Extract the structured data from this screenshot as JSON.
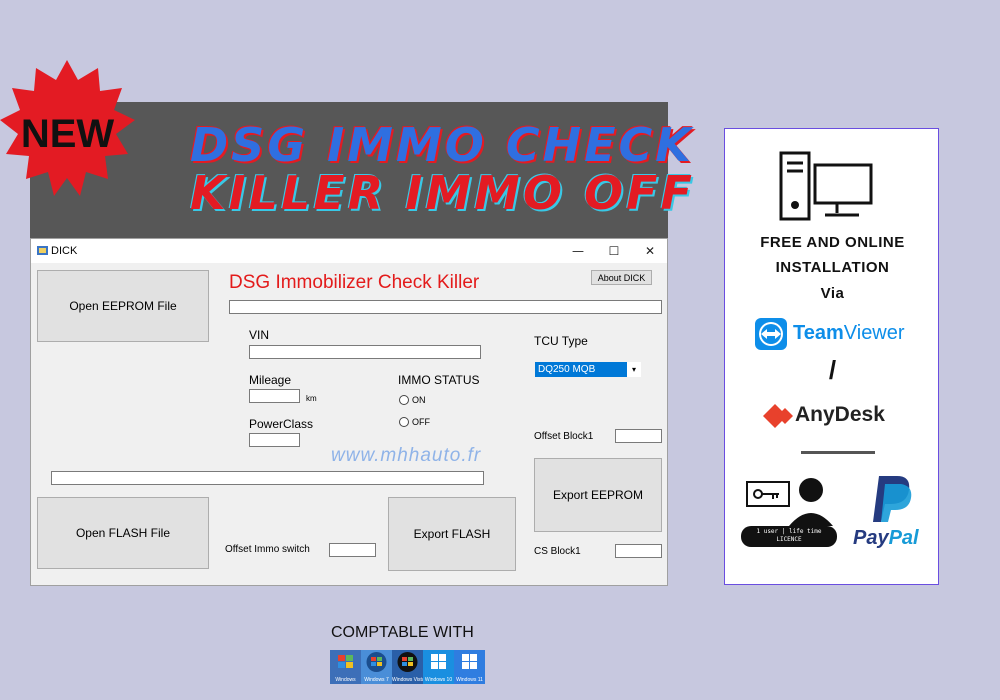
{
  "banner": {
    "badge": "NEW",
    "line1": "DSG IMMO CHECK",
    "line2": "KILLER IMMO OFF"
  },
  "window": {
    "title": "DICK",
    "controls": {
      "minimize": "—",
      "maximize": "☐",
      "close": "✕"
    },
    "app_title": "DSG Immobilizer Check Killer",
    "about_button": "About DICK",
    "open_eeprom": "Open EEPROM File",
    "open_flash": "Open FLASH File",
    "export_flash": "Export FLASH",
    "export_eeprom": "Export EEPROM",
    "vin_label": "VIN",
    "vin_value": "",
    "mileage_label": "Mileage",
    "mileage_value": "",
    "mileage_unit": "km",
    "powerclass_label": "PowerClass",
    "powerclass_value": "",
    "immo_status_label": "IMMO STATUS",
    "immo_on": "ON",
    "immo_off": "OFF",
    "tcu_type_label": "TCU Type",
    "tcu_selected": "DQ250 MQB",
    "offset_block1_label": "Offset Block1",
    "offset_block1_value": "",
    "cs_block1_label": "CS Block1",
    "cs_block1_value": "",
    "offset_immo_label": "Offset Immo switch",
    "offset_immo_value": "",
    "eeprom_path": "",
    "flash_path": "",
    "watermark": "www.mhhauto.fr"
  },
  "panel": {
    "line1": "FREE AND ONLINE",
    "line2": "INSTALLATION",
    "line3": "Via",
    "teamviewer_bold": "Team",
    "teamviewer_rest": "Viewer",
    "slash": "/",
    "anydesk": "AnyDesk",
    "licence_line1": "1 user | life time",
    "licence_line2": "LICENCE",
    "paypal_pay": "Pay",
    "paypal_pal": "Pal"
  },
  "footer": {
    "compat": "COMPTABLE WITH",
    "os": [
      "Windows",
      "Windows 7",
      "Windows Vista",
      "Windows 10",
      "Windows 11"
    ]
  },
  "colors": {
    "background": "#c7c8df",
    "banner": "#575757",
    "accent_red": "#e31b23",
    "accent_blue": "#2f6fe0",
    "teamviewer": "#0e8ee9",
    "anydesk": "#e8412c",
    "paypal_dark": "#253b80",
    "paypal_light": "#179bd7",
    "panel_border": "#6a4ee0"
  }
}
